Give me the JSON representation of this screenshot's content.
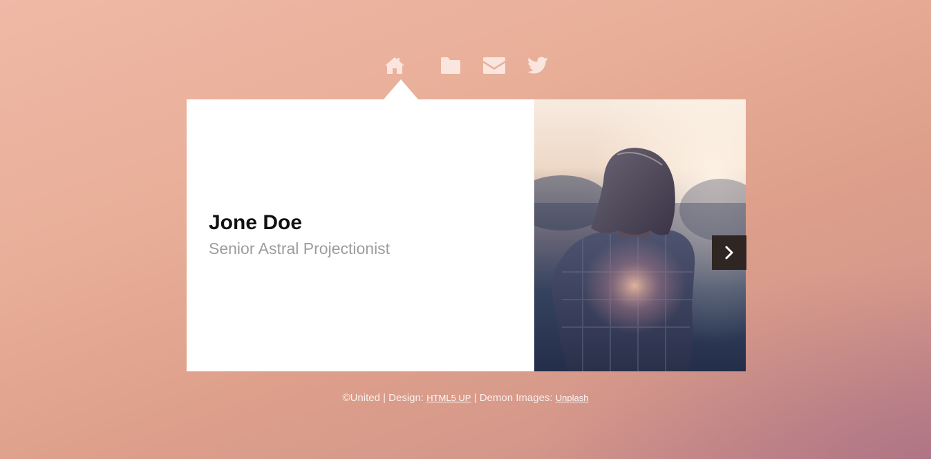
{
  "nav": {
    "items": [
      {
        "icon": "home-icon"
      },
      {
        "icon": "folder-icon"
      },
      {
        "icon": "mail-icon"
      },
      {
        "icon": "twitter-icon"
      }
    ],
    "icon_color": "#fbe6df"
  },
  "card": {
    "name": "Jone Doe",
    "role": "Senior Astral Projectionist",
    "photo": "woman-backlit-sunset-photo",
    "next_icon": "chevron-right-icon"
  },
  "footer": {
    "copyright": "©United | Design: ",
    "design_link": "HTML5 UP",
    "separator": " | Demon Images: ",
    "images_link": "Unplash"
  },
  "colors": {
    "background": "#e8ae98",
    "card": "#ffffff",
    "next_button": "#2f2624",
    "role_text": "#9c9c9c"
  }
}
